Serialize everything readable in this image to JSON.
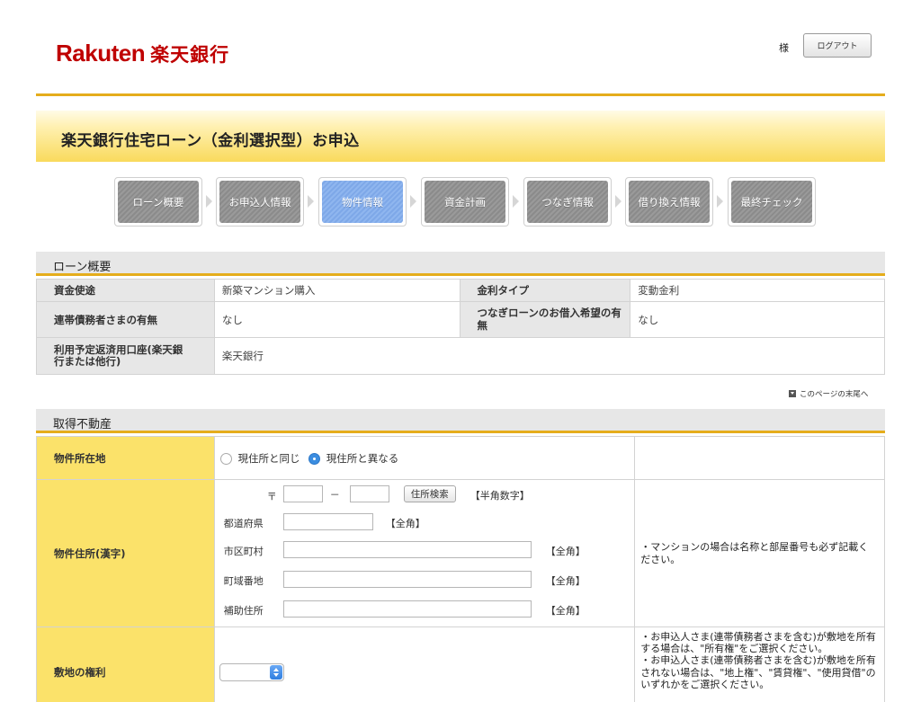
{
  "header": {
    "logo_latin": "Rakuten",
    "logo_jp": "楽天銀行",
    "user_suffix": "様",
    "logout_label": "ログアウト"
  },
  "page_title": "楽天銀行住宅ローン（金利選択型）お申込",
  "steps": [
    {
      "label": "ローン概要",
      "active": false
    },
    {
      "label": "お申込人情報",
      "active": false
    },
    {
      "label": "物件情報",
      "active": true
    },
    {
      "label": "資金計画",
      "active": false
    },
    {
      "label": "つなぎ情報",
      "active": false
    },
    {
      "label": "借り換え情報",
      "active": false
    },
    {
      "label": "最終チェック",
      "active": false
    }
  ],
  "loan_summary": {
    "heading": "ローン概要",
    "rows": [
      {
        "label1": "資金使途",
        "value1": "新築マンション購入",
        "label2": "金利タイプ",
        "value2": "変動金利"
      },
      {
        "label1": "連帯債務者さまの有無",
        "value1": "なし",
        "label2": "つなぎローンのお借入希望の有無",
        "value2": "なし"
      },
      {
        "label1": "利用予定返済用口座(楽天銀行または他行)",
        "value1": "楽天銀行"
      }
    ]
  },
  "page_end_link": "このページの末尾へ",
  "property": {
    "heading": "取得不動産",
    "location": {
      "label": "物件所在地",
      "option_same": "現住所と同じ",
      "option_diff": "現住所と異なる",
      "selected": "現住所と異なる"
    },
    "address": {
      "label": "物件住所(漢字)",
      "postal_mark": "〒",
      "dash": "－",
      "search_button": "住所検索",
      "half_width_note": "【半角数字】",
      "prefecture_label": "都道府県",
      "full_width_note": "【全角】",
      "city_label": "市区町村",
      "street_label": "町域番地",
      "extra_label": "補助住所",
      "note": "・マンションの場合は名称と部屋番号も必ず記載ください。"
    },
    "land_rights": {
      "label": "敷地の権利",
      "note": "・お申込人さま(連帯債務者さまを含む)が敷地を所有する場合は、\"所有権\"をご選択ください。\n・お申込人さま(連帯債務者さまを含む)が敷地を所有されない場合は、\"地上権\"、\"賃貸権\"、\"使用貸借\"のいずれかをご選択ください。"
    }
  },
  "colors": {
    "brand_red": "#bf0000",
    "accent_gold": "#e5ad1c",
    "active_step": "#8fb6ef",
    "field_label_bg": "#fbe26a"
  }
}
